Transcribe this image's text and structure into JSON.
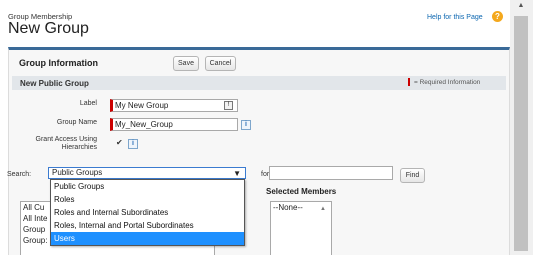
{
  "header": {
    "breadcrumb": "Group Membership",
    "title": "New Group",
    "help_link": "Help for this Page",
    "help_icon": "question-icon"
  },
  "panel": {
    "title": "Group Information",
    "save_label": "Save",
    "cancel_label": "Cancel",
    "section_title": "New Public Group",
    "required_info": "= Required Information"
  },
  "form": {
    "label_label": "Label",
    "label_value": "My New Group",
    "group_name_label": "Group Name",
    "group_name_value": "My_New_Group",
    "grant_access_label_line1": "Grant Access Using",
    "grant_access_label_line2": "Hierarchies",
    "grant_access_checked": true,
    "info_icon": "i"
  },
  "search": {
    "label": "Search:",
    "selected_value": "Public Groups",
    "for_label": "for:",
    "find_label": "Find",
    "options": [
      "Public Groups",
      "Roles",
      "Roles and Internal Subordinates",
      "Roles, Internal and Portal Subordinates",
      "Users"
    ],
    "highlighted_option": "Users"
  },
  "available_members": [
    "All Cu",
    "All Inte",
    "Group",
    "Group:"
  ],
  "selected_members": {
    "title": "Selected Members",
    "items": [
      "--None--"
    ]
  },
  "colors": {
    "accent": "#3a6a98",
    "required": "#cc0000",
    "link": "#0b66b0",
    "highlight": "#1e90ff"
  }
}
